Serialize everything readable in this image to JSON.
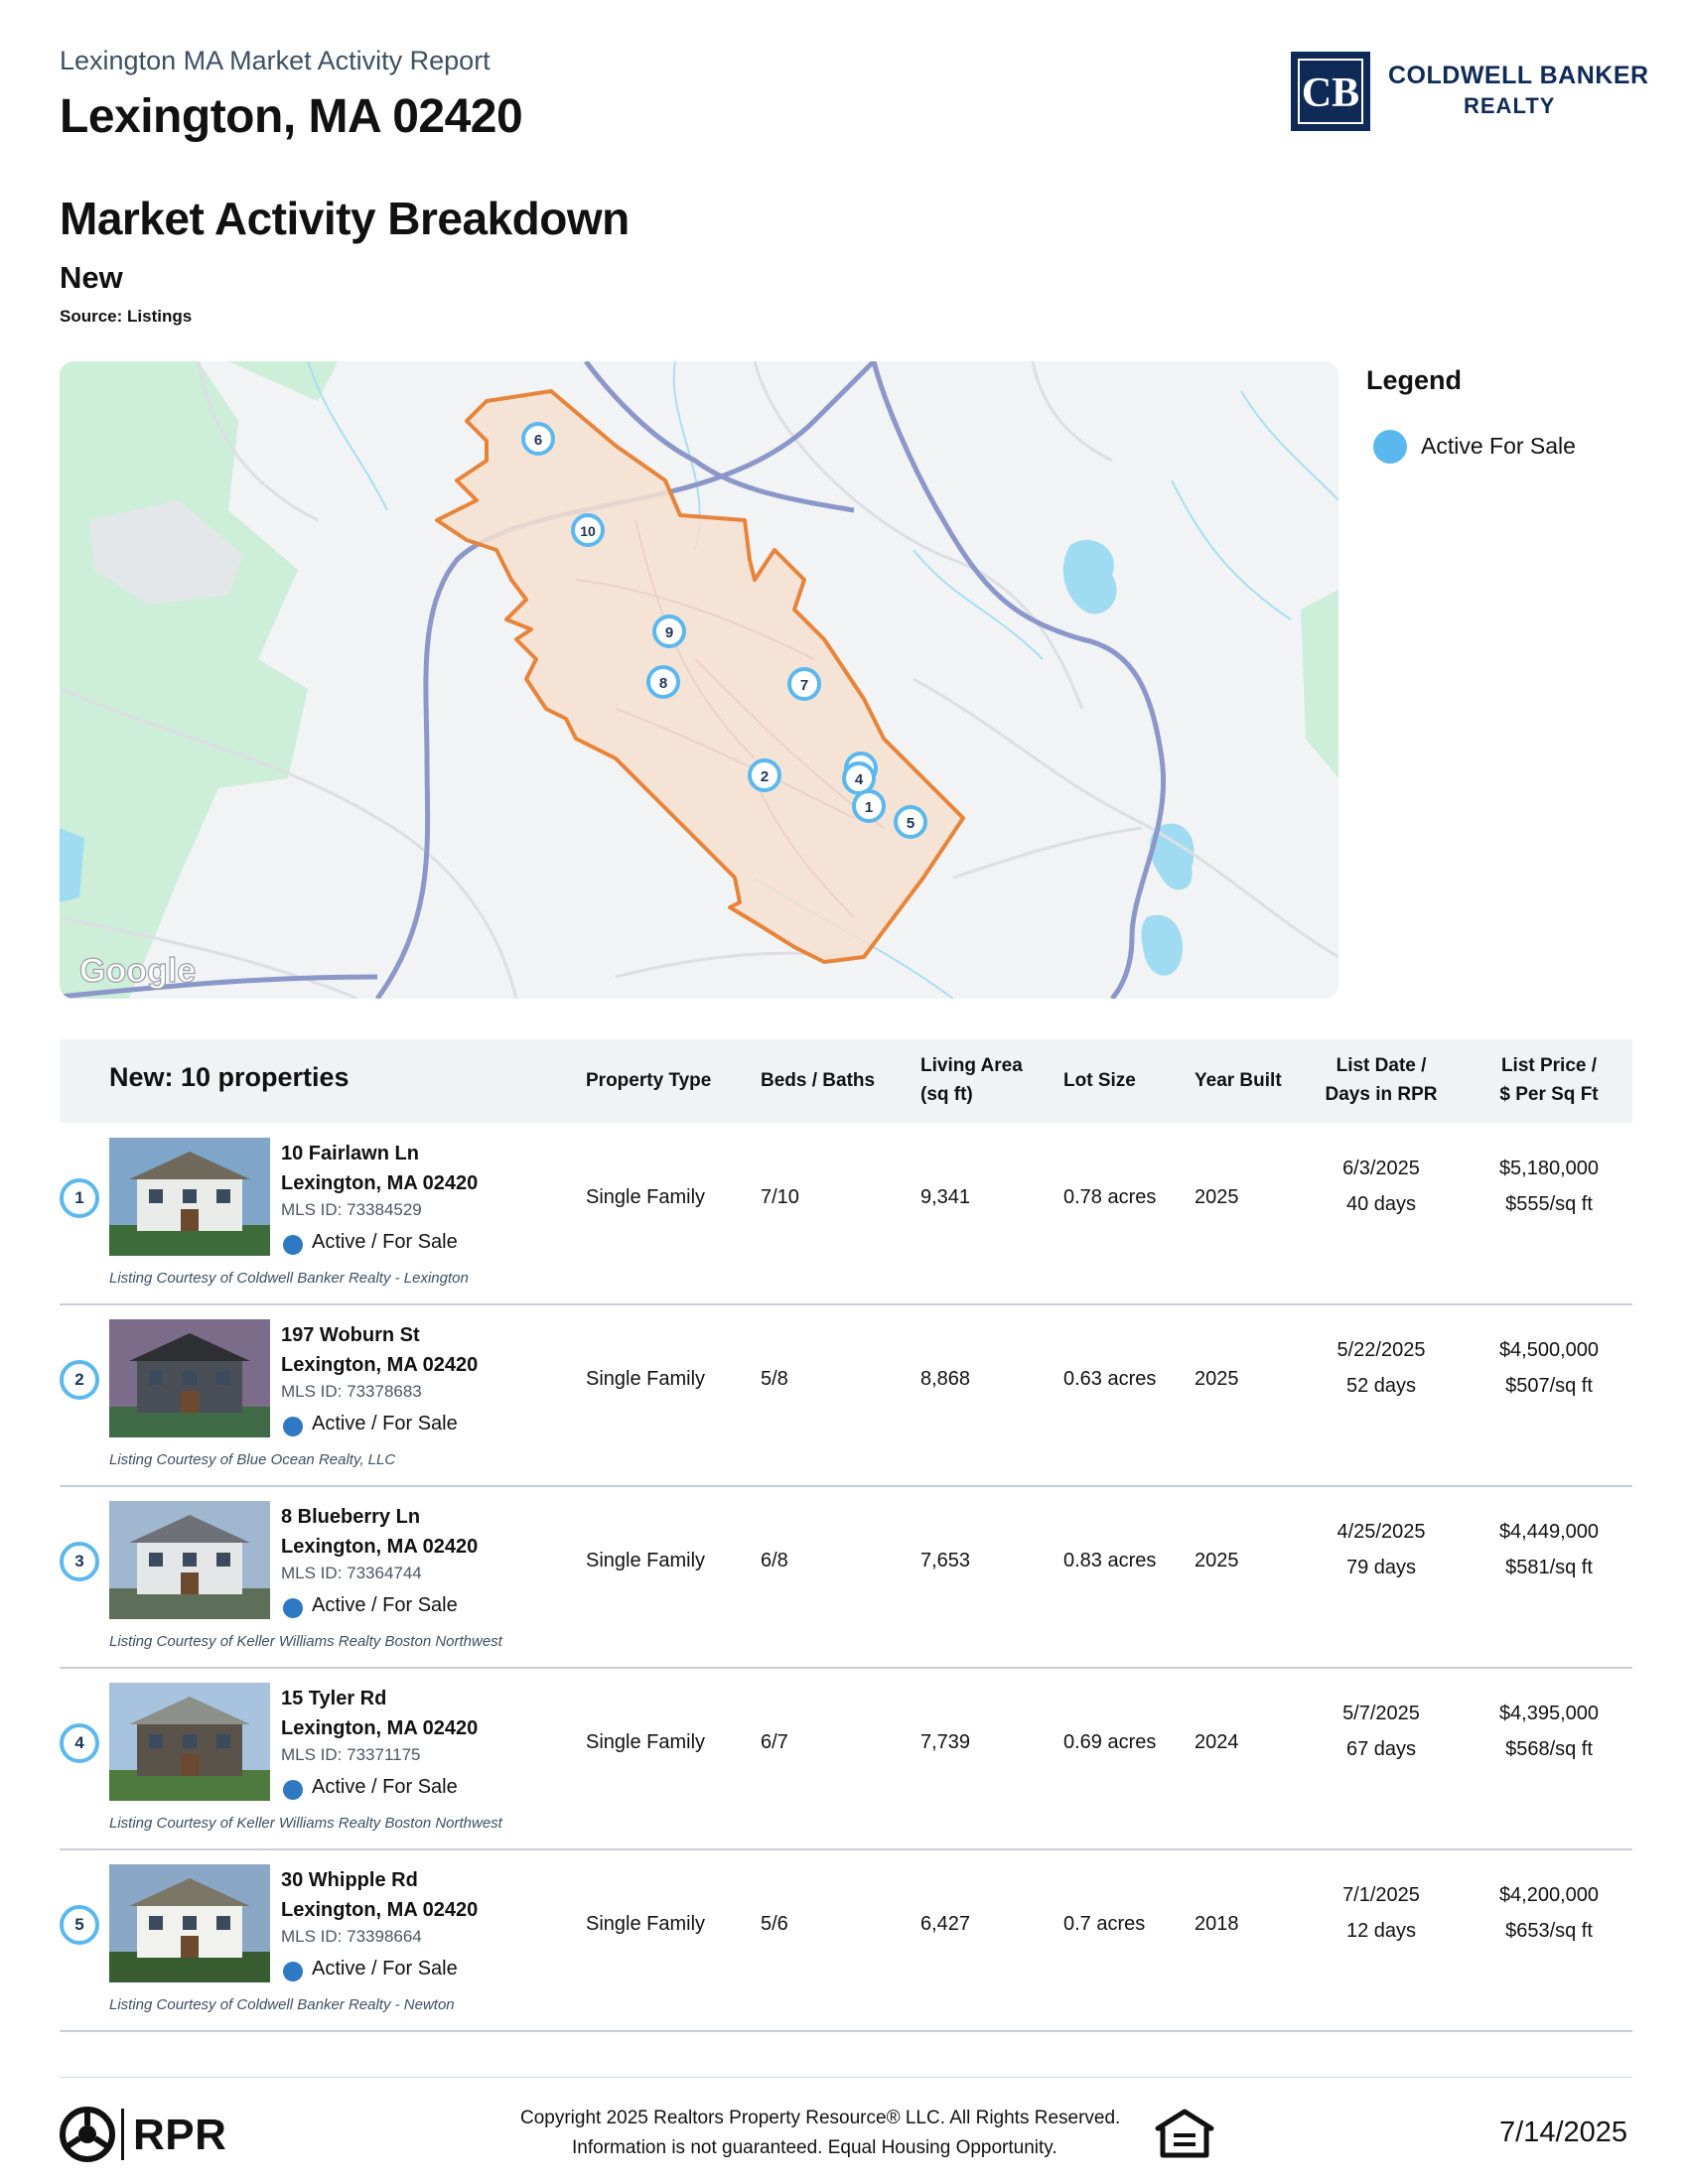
{
  "header": {
    "report_subtitle": "Lexington MA Market Activity Report",
    "title": "Lexington, MA 02420",
    "brand_line1": "COLDWELL BANKER",
    "brand_line2": "REALTY",
    "logo_letters": "CB"
  },
  "section": {
    "title": "Market Activity Breakdown",
    "subtitle": "New",
    "source": "Source: Listings"
  },
  "map": {
    "watermark": "Google",
    "markers": [
      "6",
      "10",
      "9",
      "8",
      "7",
      "2",
      "4",
      "1",
      "5"
    ]
  },
  "legend": {
    "title": "Legend",
    "items": [
      {
        "label": "Active For Sale",
        "color": "#5bb8ef"
      }
    ]
  },
  "table": {
    "title": "New: 10 properties",
    "columns": {
      "property_type": "Property Type",
      "beds_baths": "Beds / Baths",
      "living_area_1": "Living Area",
      "living_area_2": "(sq ft)",
      "lot_size": "Lot Size",
      "year_built": "Year Built",
      "list_date_1": "List Date /",
      "list_date_2": "Days in RPR",
      "list_price_1": "List Price /",
      "list_price_2": "$ Per Sq Ft"
    },
    "rows": [
      {
        "num": "1",
        "street": "10 Fairlawn Ln",
        "city": "Lexington, MA 02420",
        "mls": "MLS ID: 73384529",
        "status": "Active / For Sale",
        "courtesy": "Listing Courtesy of Coldwell Banker Realty - Lexington",
        "type": "Single Family",
        "beds_baths": "7/10",
        "area": "9,341",
        "lot": "0.78 acres",
        "year": "2025",
        "list_date": "6/3/2025",
        "days": "40 days",
        "price": "$5,180,000",
        "ppsf": "$555/sq ft"
      },
      {
        "num": "2",
        "street": "197 Woburn St",
        "city": "Lexington, MA 02420",
        "mls": "MLS ID: 73378683",
        "status": "Active / For Sale",
        "courtesy": "Listing Courtesy of Blue Ocean Realty, LLC",
        "type": "Single Family",
        "beds_baths": "5/8",
        "area": "8,868",
        "lot": "0.63 acres",
        "year": "2025",
        "list_date": "5/22/2025",
        "days": "52 days",
        "price": "$4,500,000",
        "ppsf": "$507/sq ft"
      },
      {
        "num": "3",
        "street": "8 Blueberry Ln",
        "city": "Lexington, MA 02420",
        "mls": "MLS ID: 73364744",
        "status": "Active / For Sale",
        "courtesy": "Listing Courtesy of Keller Williams Realty Boston Northwest",
        "type": "Single Family",
        "beds_baths": "6/8",
        "area": "7,653",
        "lot": "0.83 acres",
        "year": "2025",
        "list_date": "4/25/2025",
        "days": "79 days",
        "price": "$4,449,000",
        "ppsf": "$581/sq ft"
      },
      {
        "num": "4",
        "street": "15 Tyler Rd",
        "city": "Lexington, MA 02420",
        "mls": "MLS ID: 73371175",
        "status": "Active / For Sale",
        "courtesy": "Listing Courtesy of Keller Williams Realty Boston Northwest",
        "type": "Single Family",
        "beds_baths": "6/7",
        "area": "7,739",
        "lot": "0.69 acres",
        "year": "2024",
        "list_date": "5/7/2025",
        "days": "67 days",
        "price": "$4,395,000",
        "ppsf": "$568/sq ft"
      },
      {
        "num": "5",
        "street": "30 Whipple Rd",
        "city": "Lexington, MA 02420",
        "mls": "MLS ID: 73398664",
        "status": "Active / For Sale",
        "courtesy": "Listing Courtesy of Coldwell Banker Realty - Newton",
        "type": "Single Family",
        "beds_baths": "5/6",
        "area": "6,427",
        "lot": "0.7 acres",
        "year": "2018",
        "list_date": "7/1/2025",
        "days": "12 days",
        "price": "$4,200,000",
        "ppsf": "$653/sq ft"
      }
    ]
  },
  "footer": {
    "rpr": "RPR",
    "copyright": "Copyright 2025 Realtors Property Resource® LLC. All Rights Reserved.",
    "disclaimer": "Information is not guaranteed. Equal Housing Opportunity.",
    "date": "7/14/2025"
  }
}
